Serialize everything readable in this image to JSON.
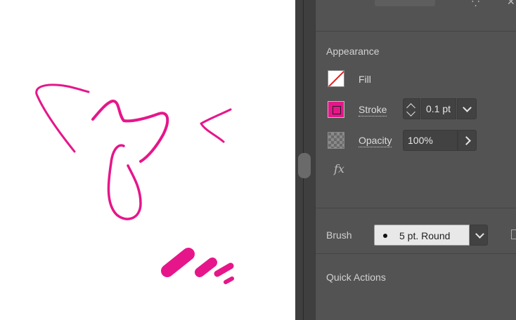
{
  "appearance": {
    "title": "Appearance",
    "fill_label": "Fill",
    "stroke_label": "Stroke",
    "stroke_weight": "0.1 pt",
    "opacity_label": "Opacity",
    "opacity_value": "100%",
    "fx_label": "fx"
  },
  "brush": {
    "label": "Brush",
    "value": "5 pt. Round"
  },
  "quick_actions": {
    "title": "Quick Actions"
  },
  "colors": {
    "stroke": "#e6168a",
    "canvas": "#ffffff",
    "panel": "#535353"
  }
}
